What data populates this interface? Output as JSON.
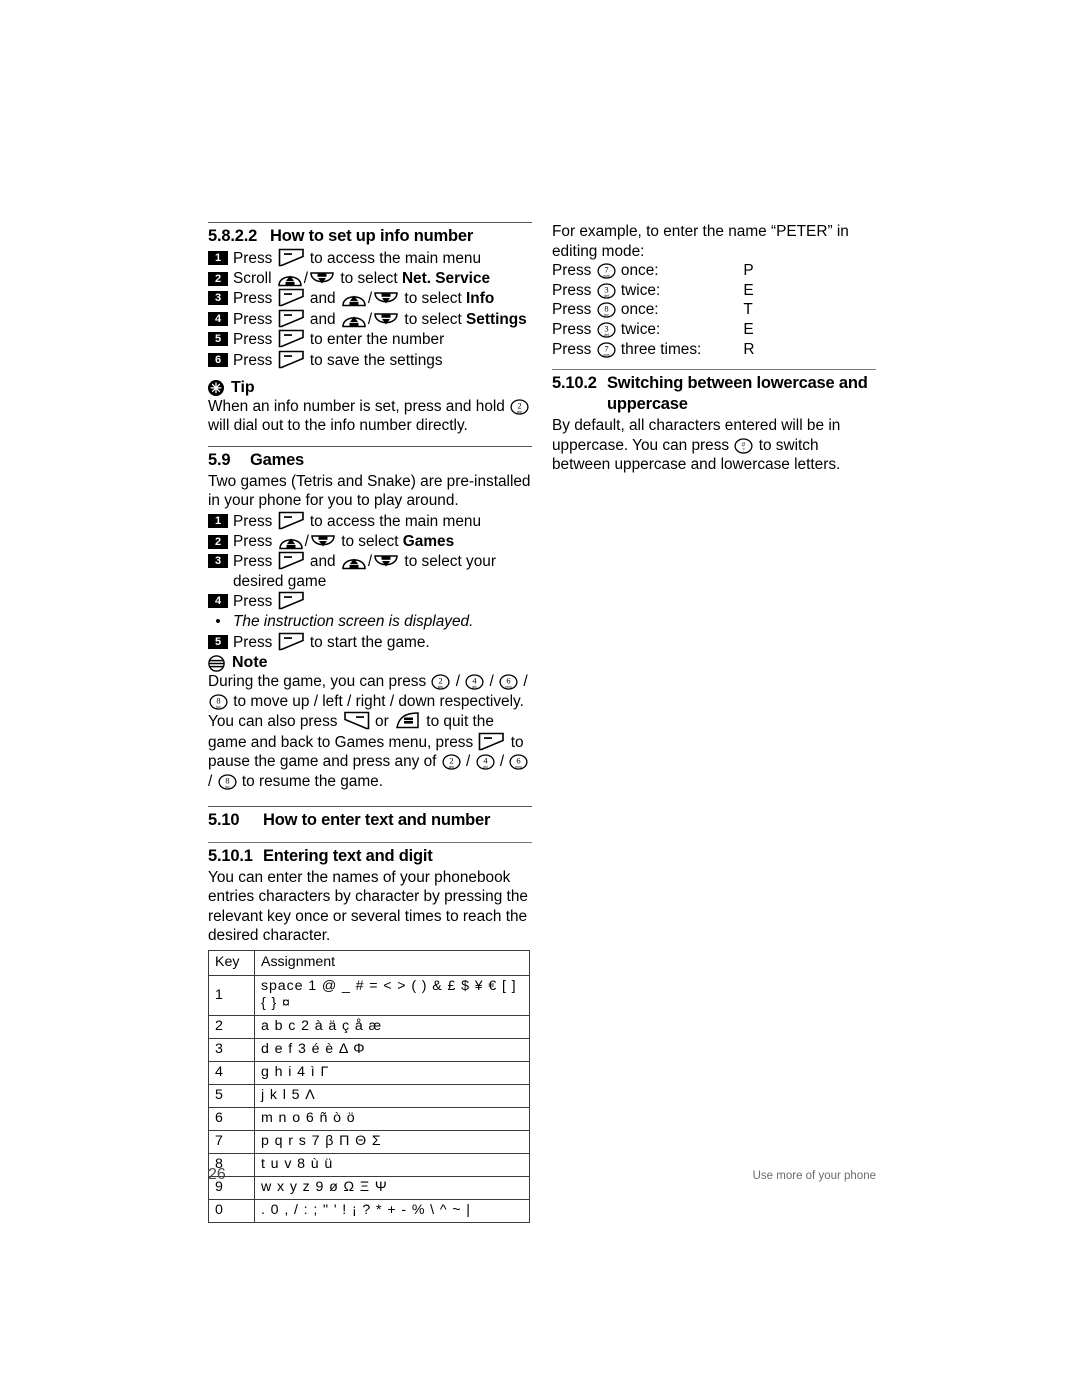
{
  "document": {
    "page_number": "26",
    "footer_text": "Use more of your phone"
  },
  "left_column": {
    "section_info": {
      "number": "5.8.2.2",
      "title": "How to set up info number",
      "steps": [
        {
          "marker": "1",
          "prefix": "Press",
          "keys": [
            "softkey-left"
          ],
          "text_after": "to access the main menu"
        },
        {
          "marker": "2",
          "prefix": "Scroll",
          "keys": [
            "up-cid",
            "down-pbk"
          ],
          "text_after": "to select",
          "bold_tail": "Net. Service"
        },
        {
          "marker": "3",
          "prefix": "Press",
          "keys": [
            "softkey-left",
            "up-cid",
            "down-pbk"
          ],
          "text_after": "to select",
          "bold_tail": "Info"
        },
        {
          "marker": "4",
          "prefix": "Press",
          "keys": [
            "softkey-left",
            "up-cid",
            "down-pbk"
          ],
          "text_after": "to select",
          "bold_tail": "Settings"
        },
        {
          "marker": "5",
          "prefix": "Press",
          "keys": [
            "softkey-left"
          ],
          "text_after": "to enter the number"
        },
        {
          "marker": "6",
          "prefix": "Press",
          "keys": [
            "softkey-left"
          ],
          "text_after": "to save the settings"
        }
      ]
    },
    "tip": {
      "label": "Tip",
      "text_before": "When an info number is set, press and hold",
      "key": "key-2",
      "text_after": "will dial out to the info number directly."
    },
    "section_games": {
      "number": "5.9",
      "title": "Games",
      "intro": "Two games (Tetris and Snake) are pre-installed in your phone for you to play around.",
      "steps": [
        {
          "marker": "1",
          "prefix": "Press",
          "keys": [
            "softkey-left"
          ],
          "text_after": "to access the main menu"
        },
        {
          "marker": "2",
          "prefix": "Press",
          "keys": [
            "up-cid",
            "down-pbk"
          ],
          "text_after": "to select",
          "bold_tail": "Games"
        },
        {
          "marker": "3",
          "prefix": "Press",
          "keys": [
            "softkey-left",
            "up-cid",
            "down-pbk"
          ],
          "text_after": "to select your desired game"
        },
        {
          "marker": "4",
          "prefix": "Press",
          "keys": [
            "softkey-left"
          ],
          "text_after": ""
        },
        {
          "marker": "bullet",
          "prefix": "",
          "keys": [],
          "text_after": "The instruction screen is displayed.",
          "italic": true
        },
        {
          "marker": "5",
          "prefix": "Press",
          "keys": [
            "softkey-left"
          ],
          "text_after": "to start the game."
        }
      ]
    },
    "note": {
      "label": "Note",
      "part1": "During the game, you can press",
      "part2": "to move up / left / right / down respectively. You can also press",
      "part3": "or",
      "part4": "to quit the game and back to Games menu, press",
      "part5": "to pause the game and press any of",
      "part6": "to resume the game."
    },
    "section_text": {
      "number": "5.10",
      "title": "How to enter text and number"
    },
    "section_text_digit": {
      "number": "5.10.1",
      "title": "Entering text and digit",
      "body": "You can enter the names of your phonebook entries characters by character by pressing the relevant key once or several times to reach the desired character."
    },
    "char_table": {
      "headers": [
        "Key",
        "Assignment"
      ],
      "rows": [
        {
          "key": "1",
          "assignment": "space 1 @ _ # = < > ( ) & £ $ ¥ € [ ] { } ¤"
        },
        {
          "key": "2",
          "assignment": "a b c 2 à ä ç å æ"
        },
        {
          "key": "3",
          "assignment": "d e f 3 é è Δ Φ"
        },
        {
          "key": "4",
          "assignment": "g h i 4 ì Γ"
        },
        {
          "key": "5",
          "assignment": "j k l 5 Λ"
        },
        {
          "key": "6",
          "assignment": "m n o 6 ñ ò ö"
        },
        {
          "key": "7",
          "assignment": "p q r s 7 β Π Θ Σ"
        },
        {
          "key": "8",
          "assignment": "t u v 8 ù ü"
        },
        {
          "key": "9",
          "assignment": "w x y z 9 ø Ω Ξ Ψ"
        },
        {
          "key": "0",
          "assignment": ". 0 , / : ; \" ' ! ¡ ? * + - % \\ ^ ~ |"
        }
      ]
    }
  },
  "right_column": {
    "example": {
      "intro": "For example, to enter the name “PETER” in editing mode:",
      "rows": [
        {
          "prefix": "Press",
          "key": "key-7",
          "count": "once:",
          "result": "P"
        },
        {
          "prefix": "Press",
          "key": "key-3",
          "count": "twice:",
          "result": "E"
        },
        {
          "prefix": "Press",
          "key": "key-8",
          "count": "once:",
          "result": "T"
        },
        {
          "prefix": "Press",
          "key": "key-3",
          "count": "twice:",
          "result": "E"
        },
        {
          "prefix": "Press",
          "key": "key-7",
          "count": "three times:",
          "result": "R"
        }
      ]
    },
    "section_case": {
      "number": "5.10.2",
      "title_line1": "Switching between lowercase and",
      "title_line2": "uppercase",
      "body_before": "By default, all characters entered will be in uppercase.  You can press",
      "key": "key-hash",
      "body_after": "to switch between uppercase and lowercase letters."
    }
  }
}
